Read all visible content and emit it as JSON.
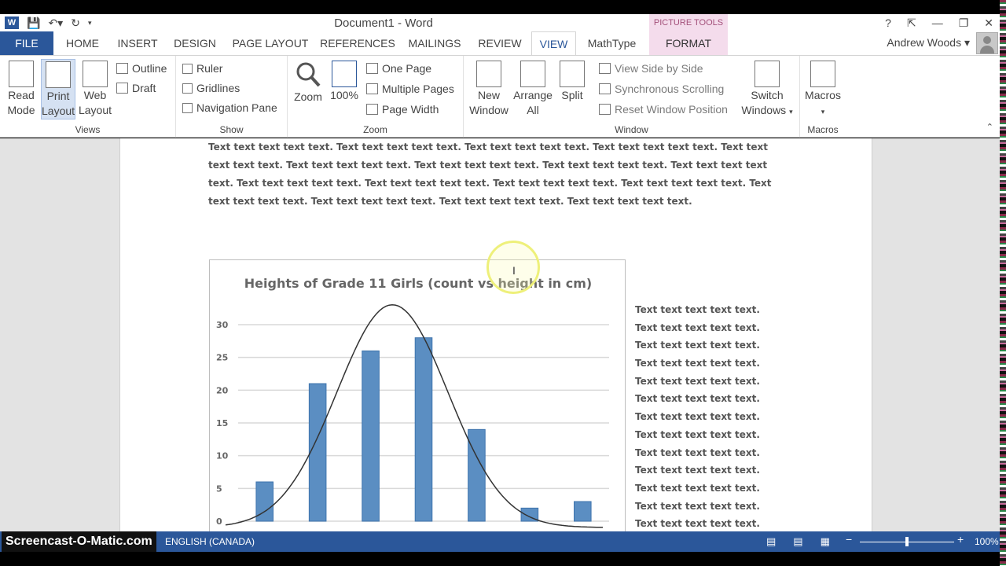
{
  "window": {
    "title": "Document1 - Word",
    "context_tools_label": "PICTURE TOOLS",
    "controls": [
      "?",
      "⇱",
      "—",
      "❐",
      "✕"
    ]
  },
  "tabs": [
    {
      "label": "FILE"
    },
    {
      "label": "HOME"
    },
    {
      "label": "INSERT"
    },
    {
      "label": "DESIGN"
    },
    {
      "label": "PAGE LAYOUT"
    },
    {
      "label": "REFERENCES"
    },
    {
      "label": "MAILINGS"
    },
    {
      "label": "REVIEW"
    },
    {
      "label": "VIEW"
    },
    {
      "label": "MathType"
    },
    {
      "label": "FORMAT"
    }
  ],
  "user_name": "Andrew Woods",
  "ribbon": {
    "views": {
      "label": "Views",
      "read_mode": "Read Mode",
      "print_layout": "Print Layout",
      "web_layout": "Web Layout",
      "outline": "Outline",
      "draft": "Draft"
    },
    "show": {
      "label": "Show",
      "ruler": "Ruler",
      "gridlines": "Gridlines",
      "navigation_pane": "Navigation Pane"
    },
    "zoom": {
      "label": "Zoom",
      "zoom": "Zoom",
      "hundred": "100%",
      "one_page": "One Page",
      "multiple_pages": "Multiple Pages",
      "page_width": "Page Width"
    },
    "window": {
      "label": "Window",
      "new_window": "New Window",
      "arrange_all": "Arrange All",
      "split": "Split",
      "side_by_side": "View Side by Side",
      "sync_scrolling": "Synchronous Scrolling",
      "reset_position": "Reset Window Position",
      "switch_windows": "Switch Windows"
    },
    "macros": {
      "label": "Macros",
      "macros": "Macros"
    }
  },
  "document": {
    "paragraph": "Text text text text text. Text text text text text. Text text text text text. Text text text text text. Text text text text text. Text text text text text. Text text text text text. Text text text text text. Text text text text text. Text text text text text. Text text text text text. Text text text text text. Text text text text text. Text text text text text. Text text text text text. Text text text text text. Text text text text text.",
    "side_lines": [
      "Text text text text text.",
      "Text text text text text.",
      "Text text text text text.",
      "Text text text text text.",
      "Text text text text text.",
      "Text text text text text.",
      "Text text text text text.",
      "Text text text text text.",
      "Text text text text text.",
      "Text text text text text.",
      "Text text text text text.",
      "Text text text text text.",
      "Text text text text text."
    ]
  },
  "chart_data": {
    "type": "bar",
    "title": "Heights of Grade 11 Girls (count vs height in cm)",
    "categories": [
      "",
      "",
      "",
      "",
      "",
      "",
      ""
    ],
    "values": [
      6,
      21,
      26,
      28,
      14,
      2,
      3
    ],
    "yticks": [
      0,
      5,
      10,
      15,
      20,
      25,
      30
    ],
    "ylim": [
      0,
      30
    ],
    "grid": true,
    "bar_color": "#5b8ec2",
    "overlay": "normal distribution curve"
  },
  "status": {
    "watermark": "Screencast-O-Matic.com",
    "language": "ENGLISH (CANADA)",
    "zoom": "100%"
  },
  "colors": {
    "accent": "#2b579a",
    "picture_tools": "#f4dcec"
  }
}
